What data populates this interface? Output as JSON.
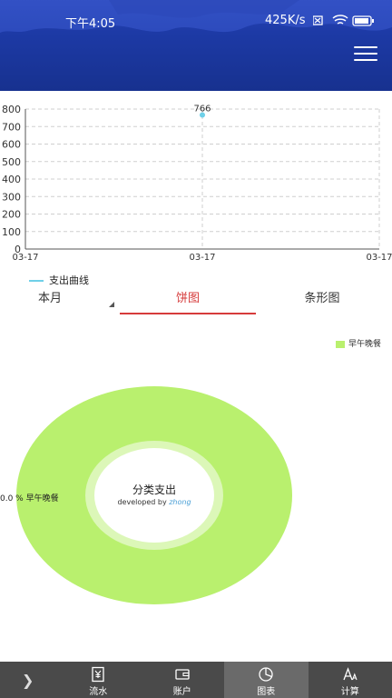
{
  "status_bar": {
    "time": "下午4:05",
    "network": "425K/s"
  },
  "line_legend": "支出曲线",
  "tabs": {
    "month": "本月",
    "pie": "饼图",
    "bar": "条形图"
  },
  "pie": {
    "legend_label": "早午晚餐",
    "slice_label": "0.0 % 早午晚餐",
    "center_title": "分类支出",
    "center_sub_prefix": "developed by ",
    "center_sub_name": "zhong"
  },
  "bottom_nav": [
    {
      "label": "流水",
      "icon": "yen-receipt-icon"
    },
    {
      "label": "账户",
      "icon": "wallet-icon"
    },
    {
      "label": "图表",
      "icon": "pie-chart-icon"
    },
    {
      "label": "计算",
      "icon": "font-size-icon"
    }
  ],
  "colors": {
    "header": "#1d3aa6",
    "line": "#6fd0e8",
    "pie": "#b9f06e",
    "active_tab": "#d63b3b",
    "nav": "#4a4a4a"
  },
  "chart_data": {
    "type": "line",
    "x": [
      "03-17"
    ],
    "x_ticks": [
      "03-17",
      "03-17",
      "03-17"
    ],
    "series": [
      {
        "name": "支出曲线",
        "values": [
          766
        ]
      }
    ],
    "data_labels": [
      "766"
    ],
    "ylim": [
      0,
      800
    ],
    "yticks": [
      0,
      100,
      200,
      300,
      400,
      500,
      600,
      700,
      800
    ],
    "grid": true
  }
}
